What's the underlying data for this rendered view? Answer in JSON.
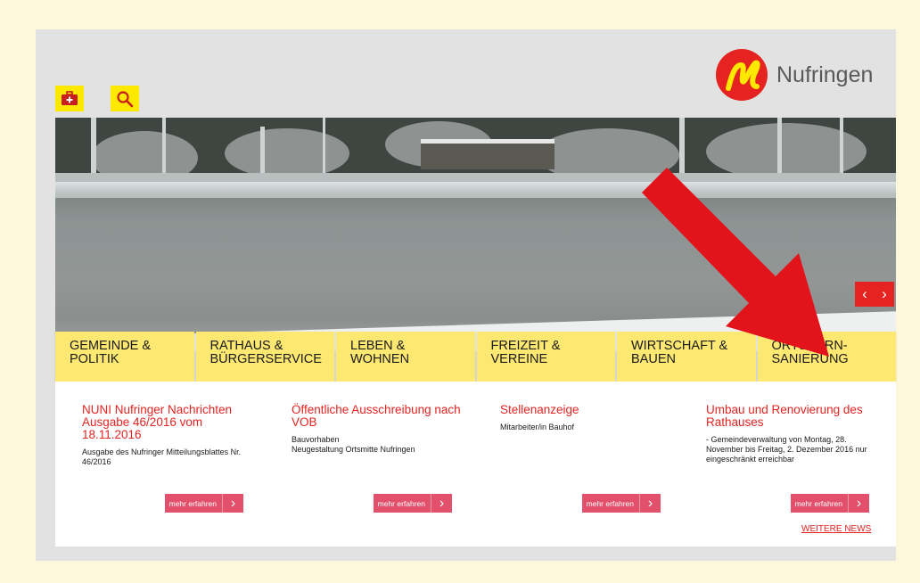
{
  "brand": {
    "name": "Nufringen",
    "logo_letter": "n",
    "color": "#e52421",
    "accent_yellow": "#fde800"
  },
  "toolbar": {
    "first_aid_icon": "first-aid-kit-icon",
    "search_icon": "search-icon"
  },
  "carousel": {
    "prev": "‹",
    "next": "›"
  },
  "nav": [
    {
      "line1": "Gemeinde &",
      "line2": "Politik"
    },
    {
      "line1": "Rathaus &",
      "line2": "Bürgerservice"
    },
    {
      "line1": "Leben &",
      "line2": "Wohnen"
    },
    {
      "line1": "Freizeit &",
      "line2": "Vereine"
    },
    {
      "line1": "Wirtschaft &",
      "line2": "Bauen"
    },
    {
      "line1": "Ortskern-",
      "line2": "Sanierung"
    }
  ],
  "news": [
    {
      "title": "NUNI Nufringer Nachrichten Ausgabe 46/2016 vom 18.11.2016",
      "desc": "Ausgabe des Nufringer Mitteilungsblattes Nr. 46/2016",
      "more": "mehr erfahren"
    },
    {
      "title": "Öffentliche Ausschreibung nach VOB",
      "desc": "Bauvorhaben\nNeugestaltung Ortsmitte Nufringen",
      "more": "mehr erfahren"
    },
    {
      "title": "Stellenanzeige",
      "desc": "Mitarbeiter/in Bauhof",
      "more": "mehr erfahren"
    },
    {
      "title": "Umbau und Renovierung des Rathauses",
      "desc": "- Gemeindeverwaltung von Montag, 28. November bis Freitag, 2. Dezember 2016 nur eingeschränkt erreichbar",
      "more": "mehr erfahren"
    }
  ],
  "more_news": "WEITERE NEWS",
  "arrow_icon": "annotation-arrow",
  "arrow_color": "#e3131b"
}
